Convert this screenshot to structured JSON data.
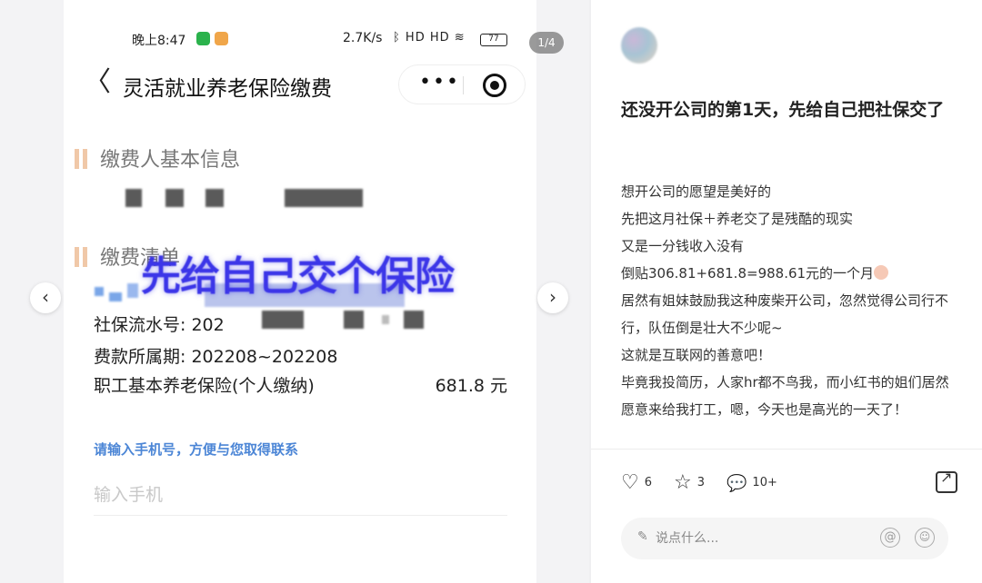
{
  "viewer": {
    "counter": "1/4",
    "prev_icon": "chevron-left-icon",
    "next_icon": "chevron-right-icon",
    "prev_symbol": "‹",
    "next_symbol": "›"
  },
  "phone": {
    "status": {
      "time": "晚上8:47",
      "speed": "2.7K/s",
      "icons": "ᛒ HD HD ≋",
      "battery": "77"
    },
    "nav": {
      "back_symbol": "〈",
      "title": "灵活就业养老保险缴费",
      "more_symbol": "•••"
    },
    "section1_title": "缴费人基本信息",
    "section2_title": "缴费清单",
    "overlay_text": "先给自己交个保险",
    "rows": {
      "serial_label": "社保流水号:",
      "serial_value": "202",
      "period_label": "费款所属期:",
      "period_value": "202208~202208",
      "pension_label": "职工基本养老保险(个人缴纳)",
      "pension_amount": "681.8 元"
    },
    "phone_hint": "请输入手机号，方便与您取得联系",
    "phone_placeholder": "输入手机"
  },
  "post": {
    "title": "还没开公司的第1天，先给自己把社保交了",
    "lines": [
      "想开公司的愿望是美好的",
      "先把这月社保＋养老交了是残酷的现实",
      "又是一分钱收入没有",
      "倒贴306.81+681.8=988.61元的一个月",
      "居然有姐妹鼓励我这种废柴开公司，忽然觉得公司行不行，队伍倒是壮大不少呢~",
      "这就是互联网的善意吧！",
      "毕竟我投简历，人家hr都不鸟我，而小红书的姐们居然愿意来给我打工，嗯，今天也是高光的一天了！"
    ],
    "actions": {
      "like_count": "6",
      "star_count": "3",
      "comment_count": "10+",
      "like_symbol": "♡",
      "star_symbol": "☆",
      "comment_symbol": "💬"
    },
    "comment_placeholder": "说点什么...",
    "pen_symbol": "✎",
    "at_symbol": "@",
    "smile_symbol": "☺"
  }
}
